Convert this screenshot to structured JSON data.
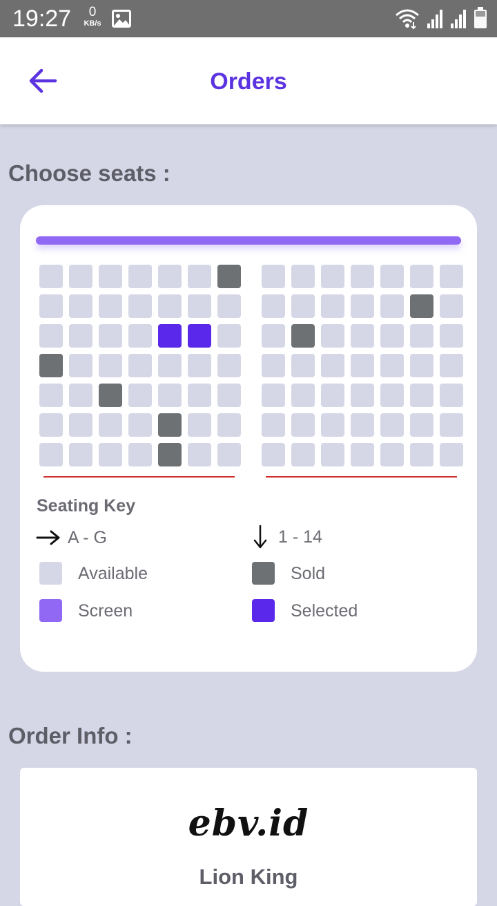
{
  "status_bar": {
    "time": "19:27",
    "speed_value": "0",
    "speed_unit": "KB/s",
    "icons": [
      "image-icon",
      "wifi-icon",
      "signal-icon",
      "signal-icon",
      "battery-icon"
    ]
  },
  "header": {
    "title": "Orders",
    "back_icon": "arrow-left-icon",
    "accent_color": "#5b33e0"
  },
  "seats_section": {
    "title": "Choose seats :",
    "screen_color": "#9068f4",
    "left_block": [
      [
        "available",
        "available",
        "available",
        "available",
        "available",
        "available",
        "sold"
      ],
      [
        "available",
        "available",
        "available",
        "available",
        "available",
        "available",
        "available"
      ],
      [
        "available",
        "available",
        "available",
        "available",
        "selected",
        "selected",
        "available"
      ],
      [
        "sold",
        "available",
        "available",
        "available",
        "available",
        "available",
        "available"
      ],
      [
        "available",
        "available",
        "sold",
        "available",
        "available",
        "available",
        "available"
      ],
      [
        "available",
        "available",
        "available",
        "available",
        "sold",
        "available",
        "available"
      ],
      [
        "available",
        "available",
        "available",
        "available",
        "sold",
        "available",
        "available"
      ]
    ],
    "right_block": [
      [
        "available",
        "available",
        "available",
        "available",
        "available",
        "available",
        "available"
      ],
      [
        "available",
        "available",
        "available",
        "available",
        "available",
        "sold",
        "available"
      ],
      [
        "available",
        "sold",
        "available",
        "available",
        "available",
        "available",
        "available"
      ],
      [
        "available",
        "available",
        "available",
        "available",
        "available",
        "available",
        "available"
      ],
      [
        "available",
        "available",
        "available",
        "available",
        "available",
        "available",
        "available"
      ],
      [
        "available",
        "available",
        "available",
        "available",
        "available",
        "available",
        "available"
      ],
      [
        "available",
        "available",
        "available",
        "available",
        "available",
        "available",
        "available"
      ]
    ]
  },
  "seating_key": {
    "title": "Seating Key",
    "rows_label": "A - G",
    "cols_label": "1 - 14",
    "available": "Available",
    "sold": "Sold",
    "screen": "Screen",
    "selected": "Selected",
    "colors": {
      "available": "#d6d7e6",
      "sold": "#6d7174",
      "screen": "#9068f4",
      "selected": "#5a28ea"
    }
  },
  "order_section": {
    "title": "Order Info :",
    "brand_logo": "ebv.id",
    "movie_title": "Lion King"
  }
}
